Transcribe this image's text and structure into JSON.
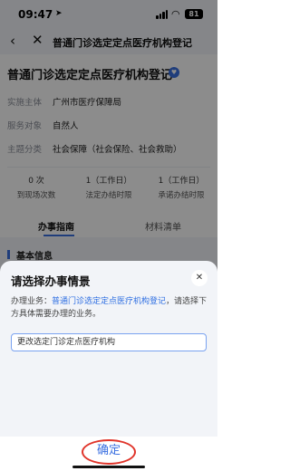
{
  "status_bar": {
    "time": "09:47",
    "battery": "81"
  },
  "nav": {
    "back_icon": "chevron-left-icon",
    "close_icon": "close-icon",
    "title": "普通门诊选定定点医疗机构登记"
  },
  "page": {
    "title": "普通门诊选定定点医疗机构登记",
    "info": [
      {
        "label": "实施主体",
        "value": "广州市医疗保障局"
      },
      {
        "label": "服务对象",
        "value": "自然人"
      },
      {
        "label": "主题分类",
        "value": "社会保障（社会保险、社会救助）"
      }
    ],
    "stats": [
      {
        "value": "0 次",
        "label": "到现场次数"
      },
      {
        "value": "1（工作日）",
        "label": "法定办结时限"
      },
      {
        "value": "1（工作日）",
        "label": "承诺办结时限"
      }
    ],
    "tabs": [
      {
        "label": "办事指南",
        "active": true
      },
      {
        "label": "材料清单",
        "active": false
      }
    ],
    "section_peek": "基本信息"
  },
  "sheet": {
    "title": "请选择办事情景",
    "desc_prefix": "办理业务：",
    "desc_link": "普通门诊选定定点医疗机构登记",
    "desc_suffix": "，请选择下方具体需要办理的业务。",
    "options": [
      "更改选定门诊定点医疗机构"
    ],
    "confirm_label": "确定"
  },
  "colors": {
    "accent": "#3a6fe0",
    "link": "#2f6fe2",
    "highlight_ring": "#e0342a"
  }
}
